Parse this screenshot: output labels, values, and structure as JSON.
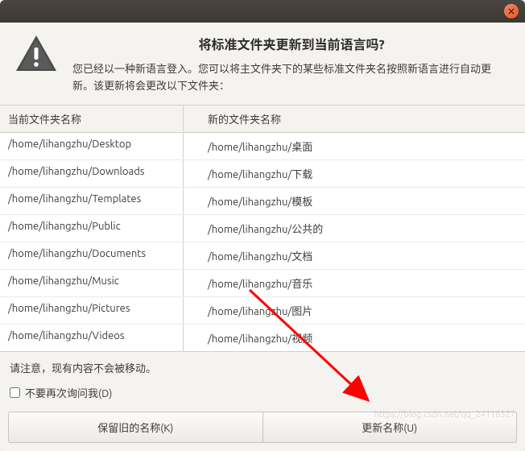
{
  "header": {
    "title": "将标准文件夹更新到当前语言吗?",
    "description": "您已经以一种新语言登入。您可以将主文件夹下的某些标准文件夹名按照新语言进行自动更新。该更新将会更改以下文件夹："
  },
  "table": {
    "col_old": "当前文件夹名称",
    "col_new": "新的文件夹名称",
    "rows": [
      {
        "old": "/home/lihangzhu/Desktop",
        "new": "/home/lihangzhu/桌面"
      },
      {
        "old": "/home/lihangzhu/Downloads",
        "new": "/home/lihangzhu/下载"
      },
      {
        "old": "/home/lihangzhu/Templates",
        "new": "/home/lihangzhu/模板"
      },
      {
        "old": "/home/lihangzhu/Public",
        "new": "/home/lihangzhu/公共的"
      },
      {
        "old": "/home/lihangzhu/Documents",
        "new": "/home/lihangzhu/文档"
      },
      {
        "old": "/home/lihangzhu/Music",
        "new": "/home/lihangzhu/音乐"
      },
      {
        "old": "/home/lihangzhu/Pictures",
        "new": "/home/lihangzhu/图片"
      },
      {
        "old": "/home/lihangzhu/Videos",
        "new": "/home/lihangzhu/视频"
      }
    ]
  },
  "note": "请注意，现有内容不会被移动。",
  "checkbox_label": "不要再次询问我(D)",
  "buttons": {
    "keep": "保留旧的名称(K)",
    "update": "更新名称(U)"
  },
  "annotation": {
    "arrow_color": "#ff0000"
  }
}
